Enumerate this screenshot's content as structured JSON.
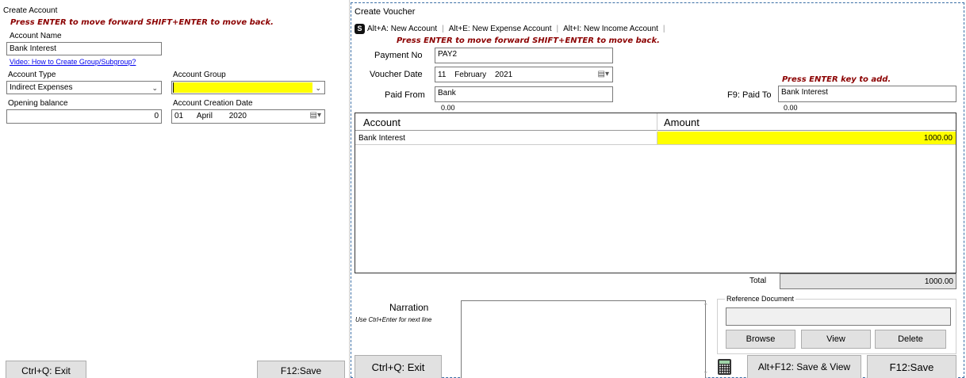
{
  "left": {
    "title": "Create Account",
    "hint": "Press ENTER to move forward  SHIFT+ENTER to move back.",
    "account_name_label": "Account Name",
    "account_name_value": "Bank Interest",
    "video_link": "Video: How to Create Group/Subgroup?",
    "account_type_label": "Account Type",
    "account_type_value": "Indirect Expenses",
    "account_group_label": "Account Group",
    "account_group_value": "",
    "opening_balance_label": "Opening balance",
    "opening_balance_value": "0",
    "creation_date_label": "Account Creation Date",
    "creation_date": {
      "day": "01",
      "month": "April",
      "year": "2020"
    },
    "exit_button": "Ctrl+Q: Exit",
    "save_button": "F12:Save"
  },
  "right": {
    "title": "Create Voucher",
    "toolbar": {
      "badge": "S",
      "new_account": "Alt+A: New Account",
      "new_expense": "Alt+E: New Expense Account",
      "new_income": "Alt+I: New Income Account"
    },
    "hint": "Press ENTER to move forward  SHIFT+ENTER to move back.",
    "payment_no_label": "Payment No",
    "payment_no_value": "PAY2",
    "voucher_date_label": "Voucher Date",
    "voucher_date": {
      "day": "11",
      "month": "February",
      "year": "2021"
    },
    "paid_from_label": "Paid From",
    "paid_from_value": "Bank",
    "paid_from_balance": "0.00",
    "add_hint": "Press ENTER key to add.",
    "paid_to_label": "F9: Paid To",
    "paid_to_value": "Bank Interest",
    "paid_to_balance": "0.00",
    "grid": {
      "columns": [
        "Account",
        "Amount"
      ],
      "rows": [
        {
          "account": "Bank Interest",
          "amount": "1000.00"
        }
      ]
    },
    "total_label": "Total",
    "total_value": "1000.00",
    "narration_label": "Narration",
    "narration_hint": "Use Ctrl+Enter for next line",
    "narration_value": "",
    "reference_label": "Reference Document",
    "reference_value": "",
    "browse_button": "Browse",
    "view_button": "View",
    "delete_button": "Delete",
    "exit_button": "Ctrl+Q: Exit",
    "save_view_button": "Alt+F12: Save & View",
    "save_button": "F12:Save"
  },
  "colors": {
    "highlight": "#ffff00",
    "hint": "#8b0000",
    "link": "#0000ee",
    "total_bg": "#e3e3e3"
  }
}
